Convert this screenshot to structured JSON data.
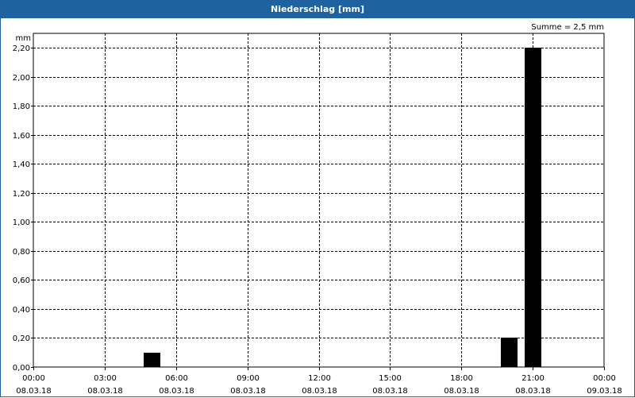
{
  "window": {
    "title": "Niederschlag [mm]"
  },
  "chart_data": {
    "type": "bar",
    "title": "Niederschlag [mm]",
    "ylabel": "mm",
    "xlabel": "",
    "annotation": "Summe = 2,5 mm",
    "ylim": [
      0,
      2.3
    ],
    "xlim_hours": [
      0,
      24
    ],
    "grid": true,
    "bar_color": "#000000",
    "y_ticks": [
      {
        "value": 0.0,
        "label": "0,00"
      },
      {
        "value": 0.2,
        "label": "0,20"
      },
      {
        "value": 0.4,
        "label": "0,40"
      },
      {
        "value": 0.6,
        "label": "0,60"
      },
      {
        "value": 0.8,
        "label": "0,80"
      },
      {
        "value": 1.0,
        "label": "1,00"
      },
      {
        "value": 1.2,
        "label": "1,20"
      },
      {
        "value": 1.4,
        "label": "1,40"
      },
      {
        "value": 1.6,
        "label": "1,60"
      },
      {
        "value": 1.8,
        "label": "1,80"
      },
      {
        "value": 2.0,
        "label": "2,00"
      },
      {
        "value": 2.2,
        "label": "2,20"
      }
    ],
    "x_ticks": [
      {
        "hour": 0,
        "time": "00:00",
        "date": "08.03.18"
      },
      {
        "hour": 3,
        "time": "03:00",
        "date": "08.03.18"
      },
      {
        "hour": 6,
        "time": "06:00",
        "date": "08.03.18"
      },
      {
        "hour": 9,
        "time": "09:00",
        "date": "08.03.18"
      },
      {
        "hour": 12,
        "time": "12:00",
        "date": "08.03.18"
      },
      {
        "hour": 15,
        "time": "15:00",
        "date": "08.03.18"
      },
      {
        "hour": 18,
        "time": "18:00",
        "date": "08.03.18"
      },
      {
        "hour": 21,
        "time": "21:00",
        "date": "08.03.18"
      },
      {
        "hour": 24,
        "time": "00:00",
        "date": "09.03.18"
      }
    ],
    "bars": [
      {
        "hour": 5,
        "value": 0.1
      },
      {
        "hour": 20,
        "value": 0.2
      },
      {
        "hour": 21,
        "value": 2.2
      }
    ]
  }
}
